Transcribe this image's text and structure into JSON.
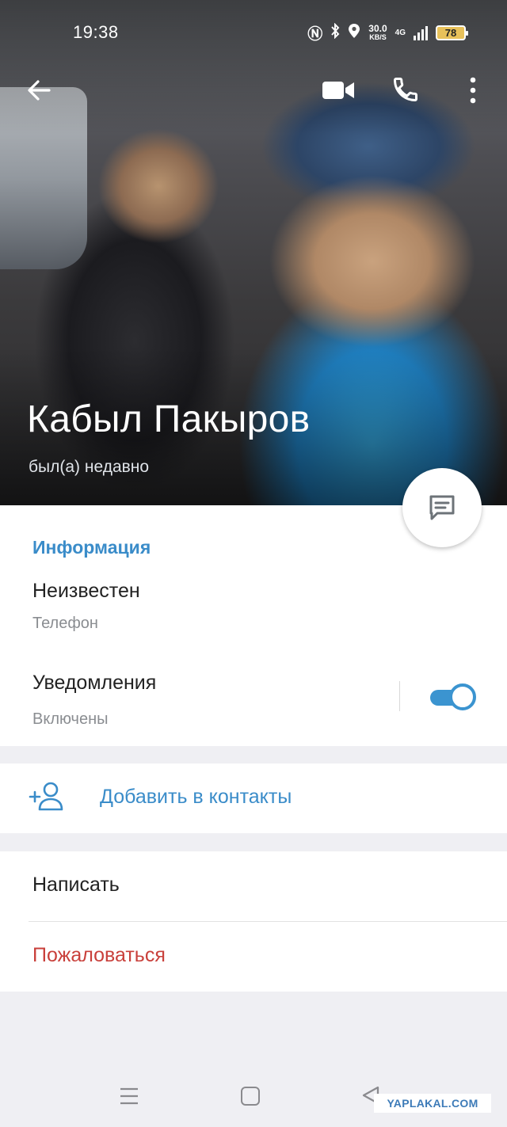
{
  "status_bar": {
    "time": "19:38",
    "net_speed": "30.0",
    "net_speed_unit": "KB/S",
    "network": "4G",
    "battery": "78"
  },
  "icons": {
    "back": "arrow-left-icon",
    "video": "video-camera-icon",
    "call": "phone-icon",
    "more": "more-vert-icon",
    "message": "message-icon",
    "add_contact": "add-person-icon"
  },
  "profile": {
    "name": "Кабыл Пакыров",
    "status": "был(а) недавно"
  },
  "info": {
    "section_title": "Информация",
    "phone_value": "Неизвестен",
    "phone_label": "Телефон",
    "notifications_title": "Уведомления",
    "notifications_value": "Включены",
    "notifications_enabled": true
  },
  "add_contact": {
    "label": "Добавить в контакты"
  },
  "actions": {
    "write": "Написать",
    "report": "Пожаловаться"
  },
  "watermark": "YAPLAKAL.COM",
  "colors": {
    "accent": "#3a8cc9",
    "danger": "#c9403b",
    "background": "#efeff3"
  }
}
